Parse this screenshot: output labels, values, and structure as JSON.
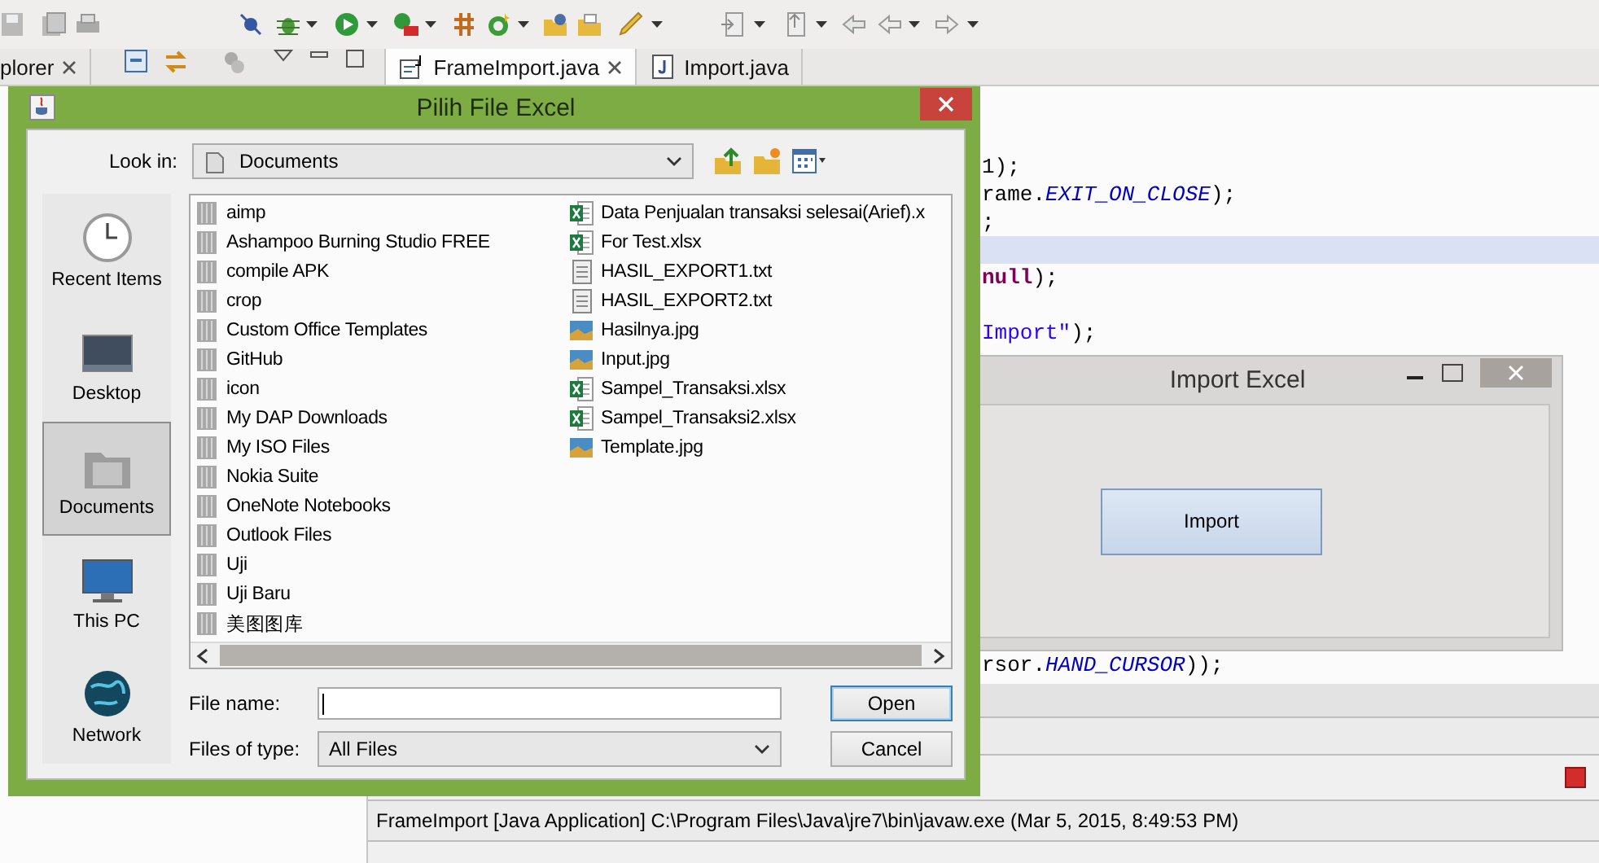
{
  "ide": {
    "explorer_tab": {
      "label": "plorer"
    },
    "editor_tabs": [
      {
        "label": "FrameImport.java",
        "selected": true
      },
      {
        "label": "Import.java",
        "selected": false
      }
    ],
    "code_lines": [
      {
        "highlighted": false
      },
      {
        "highlighted": false
      },
      {
        "highlighted": false,
        "segments": [
          {
            "kind": "plain",
            "text": "1);"
          }
        ]
      },
      {
        "highlighted": false,
        "segments": [
          {
            "kind": "plain",
            "text": "rame."
          },
          {
            "kind": "constant",
            "text": "EXIT_ON_CLOSE"
          },
          {
            "kind": "plain",
            "text": ");"
          }
        ]
      },
      {
        "highlighted": false,
        "segments": [
          {
            "kind": "plain",
            "text": ";"
          }
        ]
      },
      {
        "highlighted": true
      },
      {
        "highlighted": false,
        "segments": [
          {
            "kind": "keyword",
            "text": "null"
          },
          {
            "kind": "plain",
            "text": ");"
          }
        ]
      },
      {
        "highlighted": false
      },
      {
        "highlighted": false,
        "segments": [
          {
            "kind": "string",
            "text": "Import\""
          },
          {
            "kind": "plain",
            "text": ");"
          }
        ]
      },
      {
        "highlighted": false
      },
      {
        "highlighted": false
      },
      {
        "highlighted": false
      },
      {
        "highlighted": false
      },
      {
        "highlighted": false
      },
      {
        "highlighted": false
      },
      {
        "highlighted": false
      },
      {
        "highlighted": false
      },
      {
        "highlighted": false
      },
      {
        "highlighted": false
      },
      {
        "highlighted": false
      },
      {
        "highlighted": false,
        "segments": [
          {
            "kind": "plain",
            "text": "rsor."
          },
          {
            "kind": "constant",
            "text": "HAND_CURSOR"
          },
          {
            "kind": "plain",
            "text": "));"
          }
        ]
      }
    ],
    "console": {
      "launch_label": "FrameImport [Java Application] C:\\Program Files\\Java\\jre7\\bin\\javaw.exe (Mar 5, 2015, 8:49:53 PM)"
    }
  },
  "import_window": {
    "title": "Import Excel",
    "button": "Import"
  },
  "file_dialog": {
    "title": "Pilih File Excel",
    "look_in": {
      "label": "Look in:",
      "value": "Documents"
    },
    "places": [
      {
        "label": "Recent Items",
        "kind": "recent",
        "selected": false
      },
      {
        "label": "Desktop",
        "kind": "desktop",
        "selected": false
      },
      {
        "label": "Documents",
        "kind": "documents",
        "selected": true
      },
      {
        "label": "This PC",
        "kind": "computer",
        "selected": false
      },
      {
        "label": "Network",
        "kind": "network",
        "selected": false
      }
    ],
    "file_columns": [
      [
        {
          "name": "aimp",
          "kind": "folder"
        },
        {
          "name": "Ashampoo Burning Studio FREE",
          "kind": "folder"
        },
        {
          "name": "compile APK",
          "kind": "folder"
        },
        {
          "name": "crop",
          "kind": "folder"
        },
        {
          "name": "Custom Office Templates",
          "kind": "folder"
        },
        {
          "name": "GitHub",
          "kind": "folder"
        },
        {
          "name": "icon",
          "kind": "folder"
        },
        {
          "name": "My DAP Downloads",
          "kind": "folder"
        },
        {
          "name": "My ISO Files",
          "kind": "folder"
        },
        {
          "name": "Nokia Suite",
          "kind": "folder"
        },
        {
          "name": "OneNote Notebooks",
          "kind": "folder"
        },
        {
          "name": "Outlook Files",
          "kind": "folder"
        },
        {
          "name": "Uji",
          "kind": "folder"
        },
        {
          "name": "Uji Baru",
          "kind": "folder"
        },
        {
          "name": "美图图库",
          "kind": "folder"
        }
      ],
      [
        {
          "name": "Data Penjualan transaksi selesai(Arief).x",
          "kind": "excel"
        },
        {
          "name": "For Test.xlsx",
          "kind": "excel"
        },
        {
          "name": "HASIL_EXPORT1.txt",
          "kind": "text"
        },
        {
          "name": "HASIL_EXPORT2.txt",
          "kind": "text"
        },
        {
          "name": "Hasilnya.jpg",
          "kind": "image"
        },
        {
          "name": "Input.jpg",
          "kind": "image"
        },
        {
          "name": "Sampel_Transaksi.xlsx",
          "kind": "excel"
        },
        {
          "name": "Sampel_Transaksi2.xlsx",
          "kind": "excel"
        },
        {
          "name": "Template.jpg",
          "kind": "image"
        }
      ]
    ],
    "file_name": {
      "label": "File name:",
      "focused": true
    },
    "files_of_type": {
      "label": "Files of type:",
      "value": "All Files"
    },
    "buttons": [
      {
        "label": "Open",
        "kind": "default"
      },
      {
        "label": "Cancel",
        "kind": "normal"
      }
    ]
  }
}
